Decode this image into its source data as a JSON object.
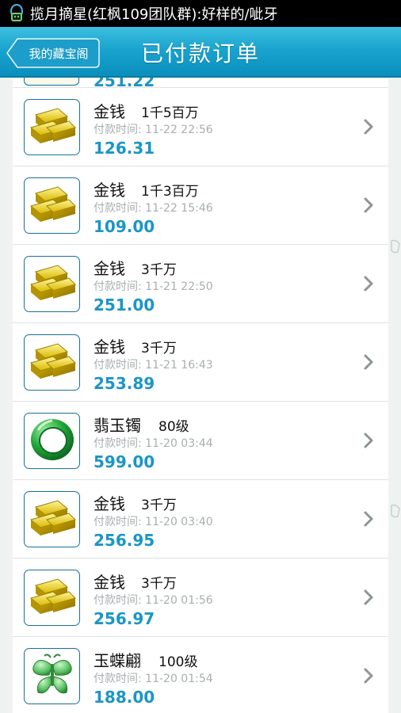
{
  "status_bar": {
    "notification_text": "揽月摘星(红枫109团队群):好样的/呲牙"
  },
  "header": {
    "back_label": "我的藏宝阁",
    "title": "已付款订单"
  },
  "orders": [
    {
      "icon": "gold-ingot-icon",
      "name": "金钱",
      "qty": "1千5百万",
      "time": "付款时间: 11-22 22:56",
      "price": "126.31"
    },
    {
      "icon": "gold-ingot-icon",
      "name": "金钱",
      "qty": "1千3百万",
      "time": "付款时间: 11-22 15:46",
      "price": "109.00"
    },
    {
      "icon": "gold-ingot-icon",
      "name": "金钱",
      "qty": "3千万",
      "time": "付款时间: 11-21 22:50",
      "price": "251.00"
    },
    {
      "icon": "gold-ingot-icon",
      "name": "金钱",
      "qty": "3千万",
      "time": "付款时间: 11-21 16:43",
      "price": "253.89"
    },
    {
      "icon": "jade-bracelet-icon",
      "name": "翡玉镯",
      "qty": "80级",
      "time": "付款时间: 11-20 03:44",
      "price": "599.00"
    },
    {
      "icon": "gold-ingot-icon",
      "name": "金钱",
      "qty": "3千万",
      "time": "付款时间: 11-20 03:40",
      "price": "256.95"
    },
    {
      "icon": "gold-ingot-icon",
      "name": "金钱",
      "qty": "3千万",
      "time": "付款时间: 11-20 01:56",
      "price": "256.97"
    },
    {
      "icon": "jade-butterfly-icon",
      "name": "玉蝶翩",
      "qty": "100级",
      "time": "付款时间: 11-20 01:54",
      "price": "188.00"
    }
  ],
  "colors": {
    "header": "#19a4cf",
    "price": "#1a96c6",
    "time": "#a8aeb0"
  }
}
